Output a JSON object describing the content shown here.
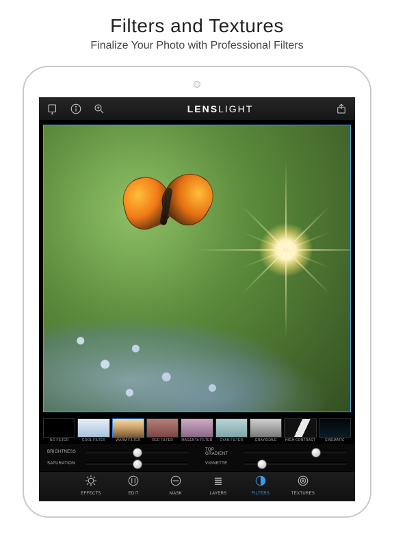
{
  "promo": {
    "title": "Filters and Textures",
    "subtitle": "Finalize Your Photo with Professional Filters"
  },
  "app": {
    "brand_bold": "LENS",
    "brand_light": "LIGHT"
  },
  "filters": [
    {
      "name": "NO FILTER",
      "css": "#000000"
    },
    {
      "name": "COOL FILTER",
      "css": "linear-gradient(#e6eef6,#a8c3de)"
    },
    {
      "name": "WARM FILTER",
      "css": "linear-gradient(#f3dca8,#caa06a,#7a5a36)"
    },
    {
      "name": "RED FILTER",
      "css": "linear-gradient(#b97d78,#7a4844)"
    },
    {
      "name": "MAGENTA FILTER",
      "css": "linear-gradient(#cfa9c4,#8a6a86)"
    },
    {
      "name": "CYAN FILTER",
      "css": "linear-gradient(#b9d4d6,#7fa7a8)"
    },
    {
      "name": "GRAYSCALE",
      "css": "linear-gradient(#cfcfcf,#7a7a7a)"
    },
    {
      "name": "HIGH CONTRAST",
      "css": "linear-gradient(115deg,#111 0 45%,#e9e9e9 45% 65%,#111 65%)"
    },
    {
      "name": "CINEMATIC",
      "css": "linear-gradient(#04060a,#0a1a24)"
    }
  ],
  "selected_filter_index": 2,
  "sliders": {
    "brightness": {
      "label": "BRIGHTNESS",
      "value": 0.5
    },
    "topgradient": {
      "label": "TOP GRADIENT",
      "value": 0.7
    },
    "saturation": {
      "label": "SATURATION",
      "value": 0.5
    },
    "vignette": {
      "label": "VIGNETTE",
      "value": 0.18
    }
  },
  "tabs": [
    {
      "id": "effects",
      "label": "EFFECTS"
    },
    {
      "id": "edit",
      "label": "EDIT"
    },
    {
      "id": "mask",
      "label": "MASK"
    },
    {
      "id": "layers",
      "label": "LAYERS"
    },
    {
      "id": "filters",
      "label": "FILTERS"
    },
    {
      "id": "textures",
      "label": "TEXTURES"
    }
  ],
  "active_tab": "filters",
  "icons": {
    "import": "import-icon",
    "info": "info-icon",
    "zoom": "zoom-in-icon",
    "share": "share-icon"
  }
}
